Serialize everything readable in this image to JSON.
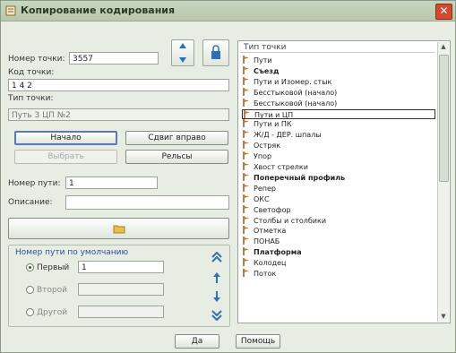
{
  "window": {
    "title": "Копирование кодирования"
  },
  "form": {
    "point_number_label": "Номер точки:",
    "point_number_value": "3557",
    "point_code_label": "Код точки:",
    "point_code_value": "1 4 2",
    "point_type_label": "Тип точки:",
    "point_type_value": "Путь 3 ЦП №2",
    "start_button": "Начало",
    "shift_right_button": "Сдвиг вправо",
    "select_button": "Выбрать",
    "rails_button": "Рельсы",
    "track_number_label": "Номер пути:",
    "track_number_value": "1",
    "description_label": "Описание:",
    "description_value": ""
  },
  "default_track": {
    "title": "Номер пути по умолчанию",
    "first_label": "Первый",
    "first_value": "1",
    "second_label": "Второй",
    "other_label": "Другой"
  },
  "list": {
    "header": "Тип точки",
    "items": [
      {
        "label": "Пути",
        "bold": false,
        "selected": false
      },
      {
        "label": "Съезд",
        "bold": true,
        "selected": false
      },
      {
        "label": "Пути и Изомер. стык",
        "bold": false,
        "selected": false
      },
      {
        "label": "Бесстыковой (начало)",
        "bold": false,
        "selected": false
      },
      {
        "label": "Бесстыковой (начало)",
        "bold": false,
        "selected": false
      },
      {
        "label": "Пути и ЦП",
        "bold": false,
        "selected": true
      },
      {
        "label": "Пути и ПК",
        "bold": false,
        "selected": false
      },
      {
        "label": "Ж/Д - ДЕР. шпалы",
        "bold": false,
        "selected": false
      },
      {
        "label": "Остряк",
        "bold": false,
        "selected": false
      },
      {
        "label": "Упор",
        "bold": false,
        "selected": false
      },
      {
        "label": "Хвост стрелки",
        "bold": false,
        "selected": false
      },
      {
        "label": "Поперечный профиль",
        "bold": true,
        "selected": false
      },
      {
        "label": "Репер",
        "bold": false,
        "selected": false
      },
      {
        "label": "ОКС",
        "bold": false,
        "selected": false
      },
      {
        "label": "Светофор",
        "bold": false,
        "selected": false
      },
      {
        "label": "Столбы и столбики",
        "bold": false,
        "selected": false
      },
      {
        "label": "Отметка",
        "bold": false,
        "selected": false
      },
      {
        "label": "ПОНАБ",
        "bold": false,
        "selected": false
      },
      {
        "label": "Платформа",
        "bold": true,
        "selected": false
      },
      {
        "label": "Колодец",
        "bold": false,
        "selected": false
      },
      {
        "label": "Поток",
        "bold": false,
        "selected": false
      }
    ]
  },
  "footer": {
    "ok_button": "Да",
    "help_button": "Помощь"
  },
  "colors": {
    "accent": "#2a4f9a",
    "close": "#d6482f",
    "icon": "#c07a30"
  }
}
